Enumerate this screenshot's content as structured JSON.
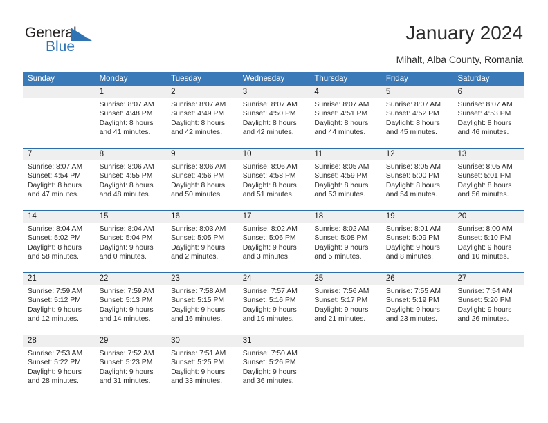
{
  "brand": {
    "name_part1": "General",
    "name_part2": "Blue",
    "accent_color": "#2e74b5"
  },
  "header": {
    "title": "January 2024",
    "subtitle": "Mihalt, Alba County, Romania"
  },
  "calendar": {
    "header_color": "#3b7ab8",
    "daynum_band_color": "#efefef",
    "weekday_labels": [
      "Sunday",
      "Monday",
      "Tuesday",
      "Wednesday",
      "Thursday",
      "Friday",
      "Saturday"
    ],
    "weeks": [
      {
        "days": [
          {
            "num": "",
            "lines": []
          },
          {
            "num": "1",
            "lines": [
              "Sunrise: 8:07 AM",
              "Sunset: 4:48 PM",
              "Daylight: 8 hours",
              "and 41 minutes."
            ]
          },
          {
            "num": "2",
            "lines": [
              "Sunrise: 8:07 AM",
              "Sunset: 4:49 PM",
              "Daylight: 8 hours",
              "and 42 minutes."
            ]
          },
          {
            "num": "3",
            "lines": [
              "Sunrise: 8:07 AM",
              "Sunset: 4:50 PM",
              "Daylight: 8 hours",
              "and 42 minutes."
            ]
          },
          {
            "num": "4",
            "lines": [
              "Sunrise: 8:07 AM",
              "Sunset: 4:51 PM",
              "Daylight: 8 hours",
              "and 44 minutes."
            ]
          },
          {
            "num": "5",
            "lines": [
              "Sunrise: 8:07 AM",
              "Sunset: 4:52 PM",
              "Daylight: 8 hours",
              "and 45 minutes."
            ]
          },
          {
            "num": "6",
            "lines": [
              "Sunrise: 8:07 AM",
              "Sunset: 4:53 PM",
              "Daylight: 8 hours",
              "and 46 minutes."
            ]
          }
        ]
      },
      {
        "days": [
          {
            "num": "7",
            "lines": [
              "Sunrise: 8:07 AM",
              "Sunset: 4:54 PM",
              "Daylight: 8 hours",
              "and 47 minutes."
            ]
          },
          {
            "num": "8",
            "lines": [
              "Sunrise: 8:06 AM",
              "Sunset: 4:55 PM",
              "Daylight: 8 hours",
              "and 48 minutes."
            ]
          },
          {
            "num": "9",
            "lines": [
              "Sunrise: 8:06 AM",
              "Sunset: 4:56 PM",
              "Daylight: 8 hours",
              "and 50 minutes."
            ]
          },
          {
            "num": "10",
            "lines": [
              "Sunrise: 8:06 AM",
              "Sunset: 4:58 PM",
              "Daylight: 8 hours",
              "and 51 minutes."
            ]
          },
          {
            "num": "11",
            "lines": [
              "Sunrise: 8:05 AM",
              "Sunset: 4:59 PM",
              "Daylight: 8 hours",
              "and 53 minutes."
            ]
          },
          {
            "num": "12",
            "lines": [
              "Sunrise: 8:05 AM",
              "Sunset: 5:00 PM",
              "Daylight: 8 hours",
              "and 54 minutes."
            ]
          },
          {
            "num": "13",
            "lines": [
              "Sunrise: 8:05 AM",
              "Sunset: 5:01 PM",
              "Daylight: 8 hours",
              "and 56 minutes."
            ]
          }
        ]
      },
      {
        "days": [
          {
            "num": "14",
            "lines": [
              "Sunrise: 8:04 AM",
              "Sunset: 5:02 PM",
              "Daylight: 8 hours",
              "and 58 minutes."
            ]
          },
          {
            "num": "15",
            "lines": [
              "Sunrise: 8:04 AM",
              "Sunset: 5:04 PM",
              "Daylight: 9 hours",
              "and 0 minutes."
            ]
          },
          {
            "num": "16",
            "lines": [
              "Sunrise: 8:03 AM",
              "Sunset: 5:05 PM",
              "Daylight: 9 hours",
              "and 2 minutes."
            ]
          },
          {
            "num": "17",
            "lines": [
              "Sunrise: 8:02 AM",
              "Sunset: 5:06 PM",
              "Daylight: 9 hours",
              "and 3 minutes."
            ]
          },
          {
            "num": "18",
            "lines": [
              "Sunrise: 8:02 AM",
              "Sunset: 5:08 PM",
              "Daylight: 9 hours",
              "and 5 minutes."
            ]
          },
          {
            "num": "19",
            "lines": [
              "Sunrise: 8:01 AM",
              "Sunset: 5:09 PM",
              "Daylight: 9 hours",
              "and 8 minutes."
            ]
          },
          {
            "num": "20",
            "lines": [
              "Sunrise: 8:00 AM",
              "Sunset: 5:10 PM",
              "Daylight: 9 hours",
              "and 10 minutes."
            ]
          }
        ]
      },
      {
        "days": [
          {
            "num": "21",
            "lines": [
              "Sunrise: 7:59 AM",
              "Sunset: 5:12 PM",
              "Daylight: 9 hours",
              "and 12 minutes."
            ]
          },
          {
            "num": "22",
            "lines": [
              "Sunrise: 7:59 AM",
              "Sunset: 5:13 PM",
              "Daylight: 9 hours",
              "and 14 minutes."
            ]
          },
          {
            "num": "23",
            "lines": [
              "Sunrise: 7:58 AM",
              "Sunset: 5:15 PM",
              "Daylight: 9 hours",
              "and 16 minutes."
            ]
          },
          {
            "num": "24",
            "lines": [
              "Sunrise: 7:57 AM",
              "Sunset: 5:16 PM",
              "Daylight: 9 hours",
              "and 19 minutes."
            ]
          },
          {
            "num": "25",
            "lines": [
              "Sunrise: 7:56 AM",
              "Sunset: 5:17 PM",
              "Daylight: 9 hours",
              "and 21 minutes."
            ]
          },
          {
            "num": "26",
            "lines": [
              "Sunrise: 7:55 AM",
              "Sunset: 5:19 PM",
              "Daylight: 9 hours",
              "and 23 minutes."
            ]
          },
          {
            "num": "27",
            "lines": [
              "Sunrise: 7:54 AM",
              "Sunset: 5:20 PM",
              "Daylight: 9 hours",
              "and 26 minutes."
            ]
          }
        ]
      },
      {
        "days": [
          {
            "num": "28",
            "lines": [
              "Sunrise: 7:53 AM",
              "Sunset: 5:22 PM",
              "Daylight: 9 hours",
              "and 28 minutes."
            ]
          },
          {
            "num": "29",
            "lines": [
              "Sunrise: 7:52 AM",
              "Sunset: 5:23 PM",
              "Daylight: 9 hours",
              "and 31 minutes."
            ]
          },
          {
            "num": "30",
            "lines": [
              "Sunrise: 7:51 AM",
              "Sunset: 5:25 PM",
              "Daylight: 9 hours",
              "and 33 minutes."
            ]
          },
          {
            "num": "31",
            "lines": [
              "Sunrise: 7:50 AM",
              "Sunset: 5:26 PM",
              "Daylight: 9 hours",
              "and 36 minutes."
            ]
          },
          {
            "num": "",
            "lines": []
          },
          {
            "num": "",
            "lines": []
          },
          {
            "num": "",
            "lines": []
          }
        ]
      }
    ]
  }
}
